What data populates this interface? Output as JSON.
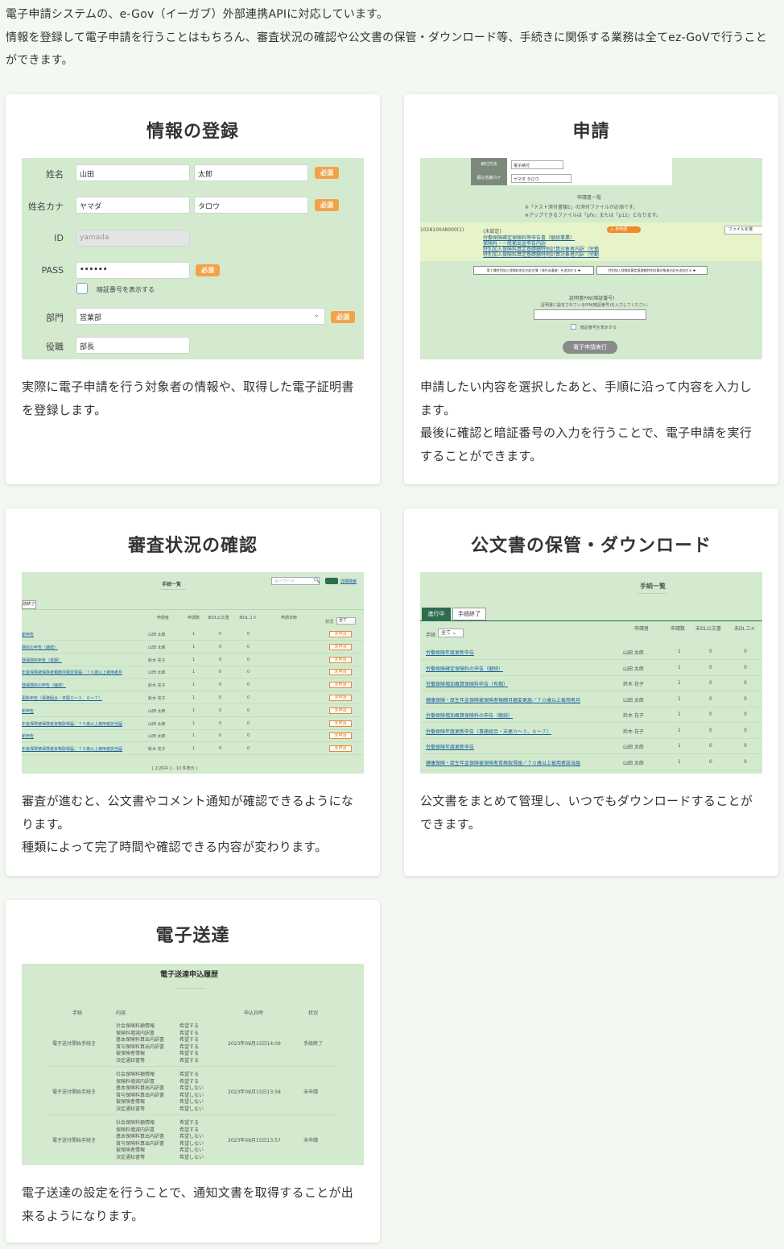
{
  "intro": {
    "line1": "電子申請システムの、e-Gov（イーガブ）外部連携APIに対応しています。",
    "line2": "情報を登録して電子申請を行うことはもちろん、審査状況の確認や公文書の保管・ダウンロード等、手続きに関係する業務は全てez-GoVで行うことができます。"
  },
  "cards": {
    "register": {
      "title": "情報の登録",
      "desc": "実際に電子申請を行う対象者の情報や、取得した電子証明書を登録します。",
      "form": {
        "name_label": "姓名",
        "last_name": "山田",
        "first_name": "太郎",
        "kana_label": "姓名カナ",
        "last_kana": "ヤマダ",
        "first_kana": "タロウ",
        "id_label": "ID",
        "id_value": "yamada",
        "pass_label": "PASS",
        "pass_value": "••••••",
        "show_pass": "暗証番号を表示する",
        "dept_label": "部門",
        "dept_value": "営業部",
        "role_label": "役職",
        "role_value": "部長",
        "required": "必須"
      }
    },
    "apply": {
      "title": "申請",
      "desc1": "申請したい内容を選択したあと、手順に沿って内容を入力します。",
      "desc2": "最後に確認と暗証番号の入力を行うことで、電子申請を実行することができます。",
      "screen": {
        "method_label": "納付方法",
        "method_value": "電子納付",
        "payer_label": "振込名義カナ",
        "payer_value": "ヤマダ タロウ",
        "list_title": "申請書一覧",
        "note1": "※「テスト添付書類1」の添付ファイルが必須です。",
        "note2": "※アップできるファイルは「pfx」または「p12」となります。",
        "id": "102810048000(1)",
        "unset": "(未設定)",
        "status": "未申請",
        "file_btn": "ファイルを選",
        "items": [
          "労働保険確定保険料等申告書（継続事業）",
          "保険料・一般拠出金申告内訳",
          "特別加入保険料算定基礎額特例計算対象者内訳（労働",
          "特別加入保険料算定基礎額特例計算対象者内訳（労動"
        ],
        "add1": "第１種特別加入保険料申告内訳名簿（海外派遣者）を追加する ✚",
        "add2": "特別加入保険料算定基礎額特例計算対象者内訳を追加する ✚",
        "pin_title": "証明書PIN(暗証番号)",
        "pin_note": "証明書に設定されているPIN(暗証番号)を入力してください。",
        "show_pin": "暗証番号を表示する",
        "exec": "電子申請実行"
      }
    },
    "status": {
      "title": "審査状況の確認",
      "desc1": "審査が進むと、公文書やコメント通知が確認できるようになります。",
      "desc2": "種類によって完了時間や確認できる内容が変わります。",
      "screen": {
        "title": "手続一覧",
        "search_placeholder": "キーワード",
        "adv": "詳細検索",
        "tab": "続終了",
        "cols": [
          "申請者",
          "申請数",
          "未DL公文書",
          "未DLコメ",
          "申請日時",
          "状況"
        ],
        "filter": "全て",
        "rows": [
          [
            "新申告",
            "山田 太郎",
            "1",
            "0",
            "0"
          ],
          [
            "険料の申告（継続）",
            "山田 太郎",
            "1",
            "0",
            "0"
          ],
          [
            "険保険料申告（有期）",
            "鈴木 花子",
            "1",
            "0",
            "0"
          ],
          [
            "年金保険被保険者報酬月額変更届／７０歳以上被用者月",
            "山田 太郎",
            "1",
            "0",
            "0"
          ],
          [
            "険保険料の申告（継続）",
            "鈴木 花子",
            "1",
            "0",
            "0"
          ],
          [
            "更新申告（事務組合・末尾０～３、６～７）",
            "鈴木 花子",
            "1",
            "0",
            "0"
          ],
          [
            "新申告",
            "山田 太郎",
            "1",
            "0",
            "0"
          ],
          [
            "年金保険被保険者資格取得届／７０歳以上被用者該当届",
            "山田 太郎",
            "1",
            "0",
            "0"
          ],
          [
            "新申告",
            "山田 太郎",
            "1",
            "0",
            "0"
          ],
          [
            "年金保険被保険者資格取得届／７０歳以上被用者該当届",
            "鈴木 花子",
            "1",
            "0",
            "0"
          ]
        ],
        "state": "未申請",
        "footer": "[ 21件中 1 - 10 件表示 ]"
      }
    },
    "docs": {
      "title": "公文書の保管・ダウンロード",
      "desc": "公文書をまとめて管理し、いつでもダウンロードすることができます。",
      "screen": {
        "title": "手続一覧",
        "tab_active": "進行中",
        "tab_other": "手続終了",
        "filter_label": "手続",
        "filter_value": "全て",
        "cols": [
          "申請者",
          "申請数",
          "未DL公文書",
          "未DLコメ"
        ],
        "rows": [
          [
            "労働保険年度更新申告",
            "山田 太郎",
            "1",
            "0",
            "0"
          ],
          [
            "労働保険確定保険料の申告（継続）",
            "山田 太郎",
            "1",
            "0",
            "0"
          ],
          [
            "労働保険増加概算保険料申告（有期）",
            "鈴木 花子",
            "1",
            "0",
            "0"
          ],
          [
            "健康保険・厚生年金保険被保険者報酬月額変更届／７０歳以上被用者月",
            "山田 太郎",
            "1",
            "0",
            "0"
          ],
          [
            "労働保険増加概算保険料の申告（継続）",
            "鈴木 花子",
            "1",
            "0",
            "0"
          ],
          [
            "労働保険年度更新申告（事務組合・末尾０～３、６～７）",
            "鈴木 花子",
            "1",
            "0",
            "0"
          ],
          [
            "労働保険年度更新申告",
            "山田 太郎",
            "1",
            "0",
            "0"
          ],
          [
            "健康保険・厚生年金保険被保険者資格取得届／７０歳以上被用者該当届",
            "山田 太郎",
            "1",
            "0",
            "0"
          ]
        ]
      }
    },
    "delivery": {
      "title": "電子送達",
      "desc": "電子送達の設定を行うことで、通知文書を取得することが出来るようになります。",
      "screen": {
        "title": "電子送達申込履歴",
        "cols": [
          "手続",
          "内容",
          "申込日時",
          "状況"
        ],
        "rows": [
          {
            "proc": "電子送付開始手続き",
            "items": [
              "社会保険料額情報",
              "保険料増減内訳書",
              "基本保険料算出内訳書",
              "賞与保険料算出内訳書",
              "被保険者情報",
              "決定通知書等"
            ],
            "flags": [
              "希望する",
              "希望する",
              "希望する",
              "希望する",
              "希望する",
              "希望する"
            ],
            "date": "2023年08月15日14:09",
            "state": "手続終了"
          },
          {
            "proc": "電子送付開始手続き",
            "items": [
              "社会保険料額情報",
              "保険料増減内訳書",
              "基本保険料算出内訳書",
              "賞与保険料算出内訳書",
              "被保険者情報",
              "決定通知書等"
            ],
            "flags": [
              "希望する",
              "希望する",
              "希望しない",
              "希望しない",
              "希望しない",
              "希望しない"
            ],
            "date": "2023年08月15日13:58",
            "state": "未申請"
          },
          {
            "proc": "電子送付開始手続き",
            "items": [
              "社会保険料額情報",
              "保険料増減内訳書",
              "基本保険料算出内訳書",
              "賞与保険料算出内訳書",
              "被保険者情報",
              "決定通知書等"
            ],
            "flags": [
              "希望する",
              "希望する",
              "希望しない",
              "希望しない",
              "希望しない",
              "希望しない"
            ],
            "date": "2023年08月15日13:57",
            "state": "未申請"
          }
        ]
      }
    }
  },
  "colors": {
    "screen_bg": "#d3eacf",
    "required": "#f4a24a",
    "link": "#1a5e9c",
    "unsubmitted": "#e28b37"
  }
}
